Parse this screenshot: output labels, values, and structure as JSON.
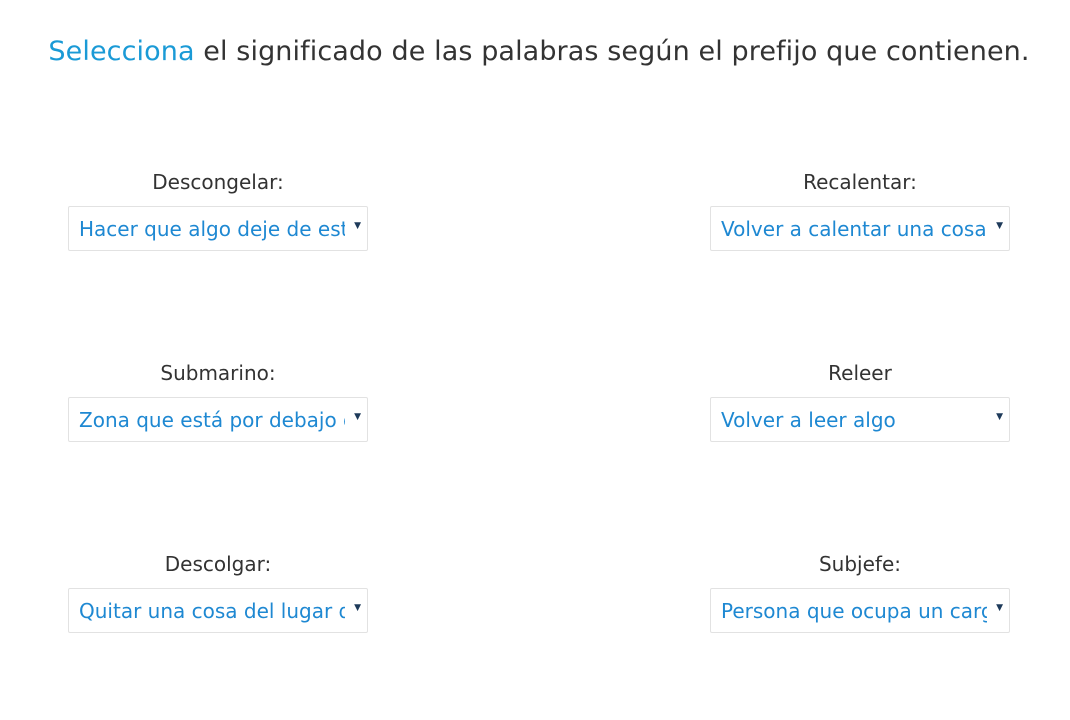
{
  "instruction": {
    "accent_word": "Selecciona",
    "rest": " el significado de las palabras según el prefijo que contienen."
  },
  "items": [
    {
      "word": "Descongelar:",
      "selected": "Hacer que algo deje de estar congelado"
    },
    {
      "word": "Recalentar:",
      "selected": "Volver a calentar una cosa"
    },
    {
      "word": "Submarino:",
      "selected": "Zona que está por debajo del mar"
    },
    {
      "word": "Releer",
      "selected": "Volver a leer algo"
    },
    {
      "word": "Descolgar:",
      "selected": "Quitar una cosa del lugar donde está colgada"
    },
    {
      "word": "Subjefe:",
      "selected": "Persona que ocupa un cargo inmediatamente inferior al jefe"
    }
  ],
  "icons": {
    "caret": "caret-down-icon"
  },
  "colors": {
    "accent": "#1a9ad6",
    "select_text": "#1e88d2",
    "label_text": "#333333",
    "border": "#e2e2e2"
  }
}
